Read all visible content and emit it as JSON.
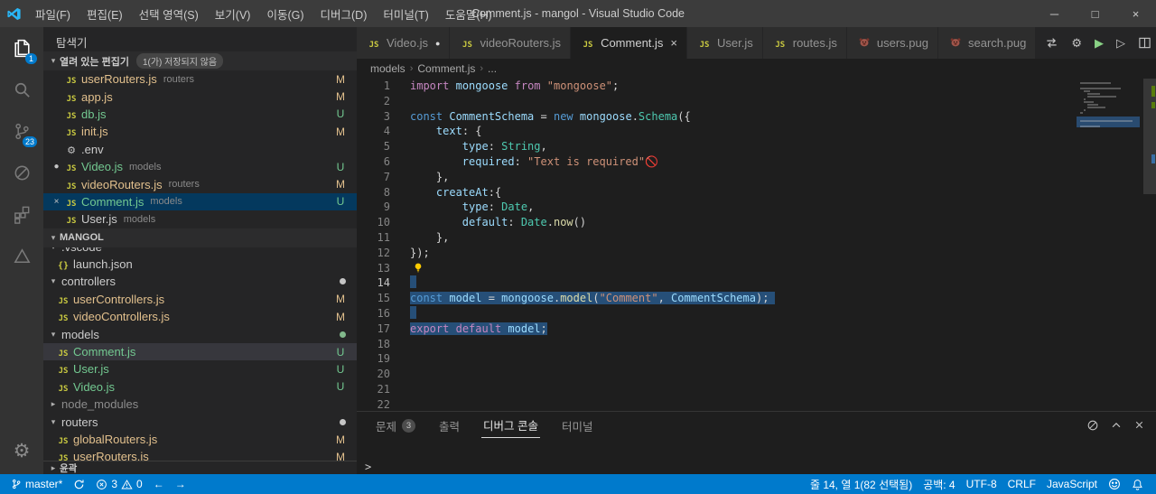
{
  "title_bar": {
    "menus": [
      "파일(F)",
      "편집(E)",
      "선택 영역(S)",
      "보기(V)",
      "이동(G)",
      "디버그(D)",
      "터미널(T)",
      "도움말(H)"
    ],
    "title": "Comment.js - mangol - Visual Studio Code",
    "window_controls": [
      "minimize",
      "maximize",
      "close"
    ]
  },
  "activity_bar": {
    "items": [
      {
        "id": "explorer",
        "icon": "files",
        "badge": "1",
        "active": true
      },
      {
        "id": "search",
        "icon": "search"
      },
      {
        "id": "source-control",
        "icon": "git",
        "badge": "23"
      },
      {
        "id": "debug",
        "icon": "debug"
      },
      {
        "id": "extensions",
        "icon": "ext"
      },
      {
        "id": "custom-tool",
        "icon": "tri"
      }
    ]
  },
  "sidebar": {
    "title": "탐색기",
    "open_editors": {
      "header": "열려 있는 편집기",
      "badge": "1(가) 저장되지 않음",
      "items": [
        {
          "icon": "js",
          "name": "userRouters.js",
          "detail": "routers",
          "status": "M",
          "git": "modified"
        },
        {
          "icon": "js",
          "name": "app.js",
          "detail": "",
          "status": "M",
          "git": "modified"
        },
        {
          "icon": "js",
          "name": "db.js",
          "detail": "",
          "status": "U",
          "git": "untracked"
        },
        {
          "icon": "js",
          "name": "init.js",
          "detail": "",
          "status": "M",
          "git": "modified"
        },
        {
          "icon": "env",
          "name": ".env",
          "detail": "",
          "status": "",
          "git": ""
        },
        {
          "icon": "js",
          "name": "Video.js",
          "detail": "models",
          "status": "U",
          "git": "untracked",
          "dirty": true
        },
        {
          "icon": "js",
          "name": "videoRouters.js",
          "detail": "routers",
          "status": "M",
          "git": "modified"
        },
        {
          "icon": "js",
          "name": "Comment.js",
          "detail": "models",
          "status": "U",
          "git": "untracked",
          "active": true
        },
        {
          "icon": "js",
          "name": "User.js",
          "detail": "models",
          "status": "",
          "git": ""
        }
      ]
    },
    "tree": {
      "header": "MANGOL",
      "items": [
        {
          "type": "folder",
          "name": ".vscode",
          "twistie": "expanded"
        },
        {
          "type": "file",
          "icon": "json",
          "name": "launch.json",
          "status": "",
          "git": ""
        },
        {
          "type": "folder",
          "name": "controllers",
          "twistie": "expanded",
          "dot": "modified"
        },
        {
          "type": "file",
          "icon": "js",
          "name": "userControllers.js",
          "status": "M",
          "git": "modified"
        },
        {
          "type": "file",
          "icon": "js",
          "name": "videoControllers.js",
          "status": "M",
          "git": "modified"
        },
        {
          "type": "folder",
          "name": "models",
          "twistie": "expanded",
          "dot": "untracked"
        },
        {
          "type": "file",
          "icon": "js",
          "name": "Comment.js",
          "status": "U",
          "git": "untracked",
          "selected": true
        },
        {
          "type": "file",
          "icon": "js",
          "name": "User.js",
          "status": "U",
          "git": "untracked"
        },
        {
          "type": "file",
          "icon": "js",
          "name": "Video.js",
          "status": "U",
          "git": "untracked"
        },
        {
          "type": "folder",
          "name": "node_modules",
          "twistie": "collapsed",
          "muted": true
        },
        {
          "type": "folder",
          "name": "routers",
          "twistie": "expanded",
          "dot": "modified"
        },
        {
          "type": "file",
          "icon": "js",
          "name": "globalRouters.js",
          "status": "M",
          "git": "modified"
        },
        {
          "type": "file",
          "icon": "js",
          "name": "userRouters.js",
          "status": "M",
          "git": "modified"
        }
      ]
    },
    "outline_header": "윤곽"
  },
  "editor": {
    "tabs": [
      {
        "icon": "js",
        "label": "Video.js",
        "git": "untracked",
        "dirty": true
      },
      {
        "icon": "js",
        "label": "videoRouters.js",
        "git": "modified"
      },
      {
        "icon": "js",
        "label": "Comment.js",
        "git": "untracked",
        "active": true,
        "closable": true
      },
      {
        "icon": "js",
        "label": "User.js",
        "git": "untracked"
      },
      {
        "icon": "js",
        "label": "routes.js",
        "git": ""
      },
      {
        "icon": "pug",
        "label": "users.pug",
        "git": ""
      },
      {
        "icon": "pug",
        "label": "search.pug",
        "git": ""
      }
    ],
    "actions": [
      {
        "id": "toggle-preview",
        "icon": "switch"
      },
      {
        "id": "settings-gear",
        "icon": "gear"
      },
      {
        "id": "start-debug",
        "icon": "play-green"
      },
      {
        "id": "run-file",
        "icon": "play-outline"
      },
      {
        "id": "split-editor",
        "icon": "split"
      },
      {
        "id": "more-actions",
        "icon": "more"
      }
    ],
    "breadcrumbs": [
      "models",
      "Comment.js",
      "..."
    ],
    "code_lines": [
      {
        "n": 1,
        "t": [
          [
            "kw",
            "import"
          ],
          [
            "pl",
            " "
          ],
          [
            "vr",
            "mongoose"
          ],
          [
            "pl",
            " "
          ],
          [
            "kw",
            "from"
          ],
          [
            "pl",
            " "
          ],
          [
            "st",
            "\"mongoose\""
          ],
          [
            "pl",
            ";"
          ]
        ]
      },
      {
        "n": 2,
        "t": []
      },
      {
        "n": 3,
        "t": [
          [
            "kb",
            "const"
          ],
          [
            "pl",
            " "
          ],
          [
            "vr",
            "CommentSchema"
          ],
          [
            "pl",
            " = "
          ],
          [
            "kb",
            "new"
          ],
          [
            "pl",
            " "
          ],
          [
            "vr",
            "mongoose"
          ],
          [
            "pl",
            "."
          ],
          [
            "cl",
            "Schema"
          ],
          [
            "pl",
            "({"
          ]
        ]
      },
      {
        "n": 4,
        "t": [
          [
            "pl",
            "    "
          ],
          [
            "vr",
            "text"
          ],
          [
            "pl",
            ": {"
          ]
        ]
      },
      {
        "n": 5,
        "t": [
          [
            "pl",
            "        "
          ],
          [
            "vr",
            "type"
          ],
          [
            "pl",
            ": "
          ],
          [
            "cl",
            "String"
          ],
          [
            "pl",
            ","
          ]
        ]
      },
      {
        "n": 6,
        "t": [
          [
            "pl",
            "        "
          ],
          [
            "vr",
            "required"
          ],
          [
            "pl",
            ": "
          ],
          [
            "st",
            "\"Text is required\""
          ],
          [
            "pl",
            "🚫"
          ]
        ]
      },
      {
        "n": 7,
        "t": [
          [
            "pl",
            "    },"
          ]
        ]
      },
      {
        "n": 8,
        "t": [
          [
            "pl",
            "    "
          ],
          [
            "vr",
            "createAt"
          ],
          [
            "pl",
            ":{"
          ]
        ]
      },
      {
        "n": 9,
        "t": [
          [
            "pl",
            "        "
          ],
          [
            "vr",
            "type"
          ],
          [
            "pl",
            ": "
          ],
          [
            "cl",
            "Date"
          ],
          [
            "pl",
            ","
          ]
        ]
      },
      {
        "n": 10,
        "t": [
          [
            "pl",
            "        "
          ],
          [
            "vr",
            "default"
          ],
          [
            "pl",
            ": "
          ],
          [
            "cl",
            "Date"
          ],
          [
            "pl",
            "."
          ],
          [
            "fn",
            "now"
          ],
          [
            "pl",
            "()"
          ]
        ]
      },
      {
        "n": 11,
        "t": [
          [
            "pl",
            "    },"
          ]
        ]
      },
      {
        "n": 12,
        "t": [
          [
            "pl",
            "});"
          ]
        ]
      },
      {
        "n": 13,
        "t": [],
        "bulb": true
      },
      {
        "n": 14,
        "t": [],
        "sel": "eol",
        "cursor": true
      },
      {
        "n": 15,
        "t": [
          [
            "kb",
            "const"
          ],
          [
            "pl",
            " "
          ],
          [
            "vr",
            "model"
          ],
          [
            "pl",
            " = "
          ],
          [
            "vr",
            "mongoose"
          ],
          [
            "pl",
            "."
          ],
          [
            "fn",
            "model"
          ],
          [
            "pl",
            "("
          ],
          [
            "st",
            "\"Comment\""
          ],
          [
            "pl",
            ", "
          ],
          [
            "vr",
            "CommentSchema"
          ],
          [
            "pl",
            ");"
          ]
        ],
        "sel": "full"
      },
      {
        "n": 16,
        "t": [],
        "sel": "eol"
      },
      {
        "n": 17,
        "t": [
          [
            "kw",
            "export"
          ],
          [
            "pl",
            " "
          ],
          [
            "kw",
            "default"
          ],
          [
            "pl",
            " "
          ],
          [
            "vr",
            "model"
          ],
          [
            "pl",
            ";"
          ]
        ],
        "sel": "text"
      },
      {
        "n": 18,
        "t": []
      },
      {
        "n": 19,
        "t": []
      },
      {
        "n": 20,
        "t": []
      },
      {
        "n": 21,
        "t": []
      },
      {
        "n": 22,
        "t": []
      }
    ]
  },
  "panel": {
    "tabs": [
      {
        "label": "문제",
        "badge": "3"
      },
      {
        "label": "출력"
      },
      {
        "label": "디버그 콘솔",
        "active": true
      },
      {
        "label": "터미널"
      }
    ],
    "actions": [
      {
        "id": "clear-console",
        "icon": "clear"
      },
      {
        "id": "maximize-panel",
        "icon": "chev-up"
      },
      {
        "id": "close-panel",
        "icon": "close"
      }
    ],
    "prompt": ">"
  },
  "status_bar": {
    "branch": "master*",
    "errors": "3",
    "warnings": "0",
    "cursor": "줄 14, 열 1(82 선택됨)",
    "indent": "공백: 4",
    "encoding": "UTF-8",
    "eol": "CRLF",
    "language": "JavaScript"
  },
  "colors": {
    "accent": "#007acc",
    "modified": "#e2c08d",
    "untracked": "#73c991",
    "selection": "#264f78"
  }
}
